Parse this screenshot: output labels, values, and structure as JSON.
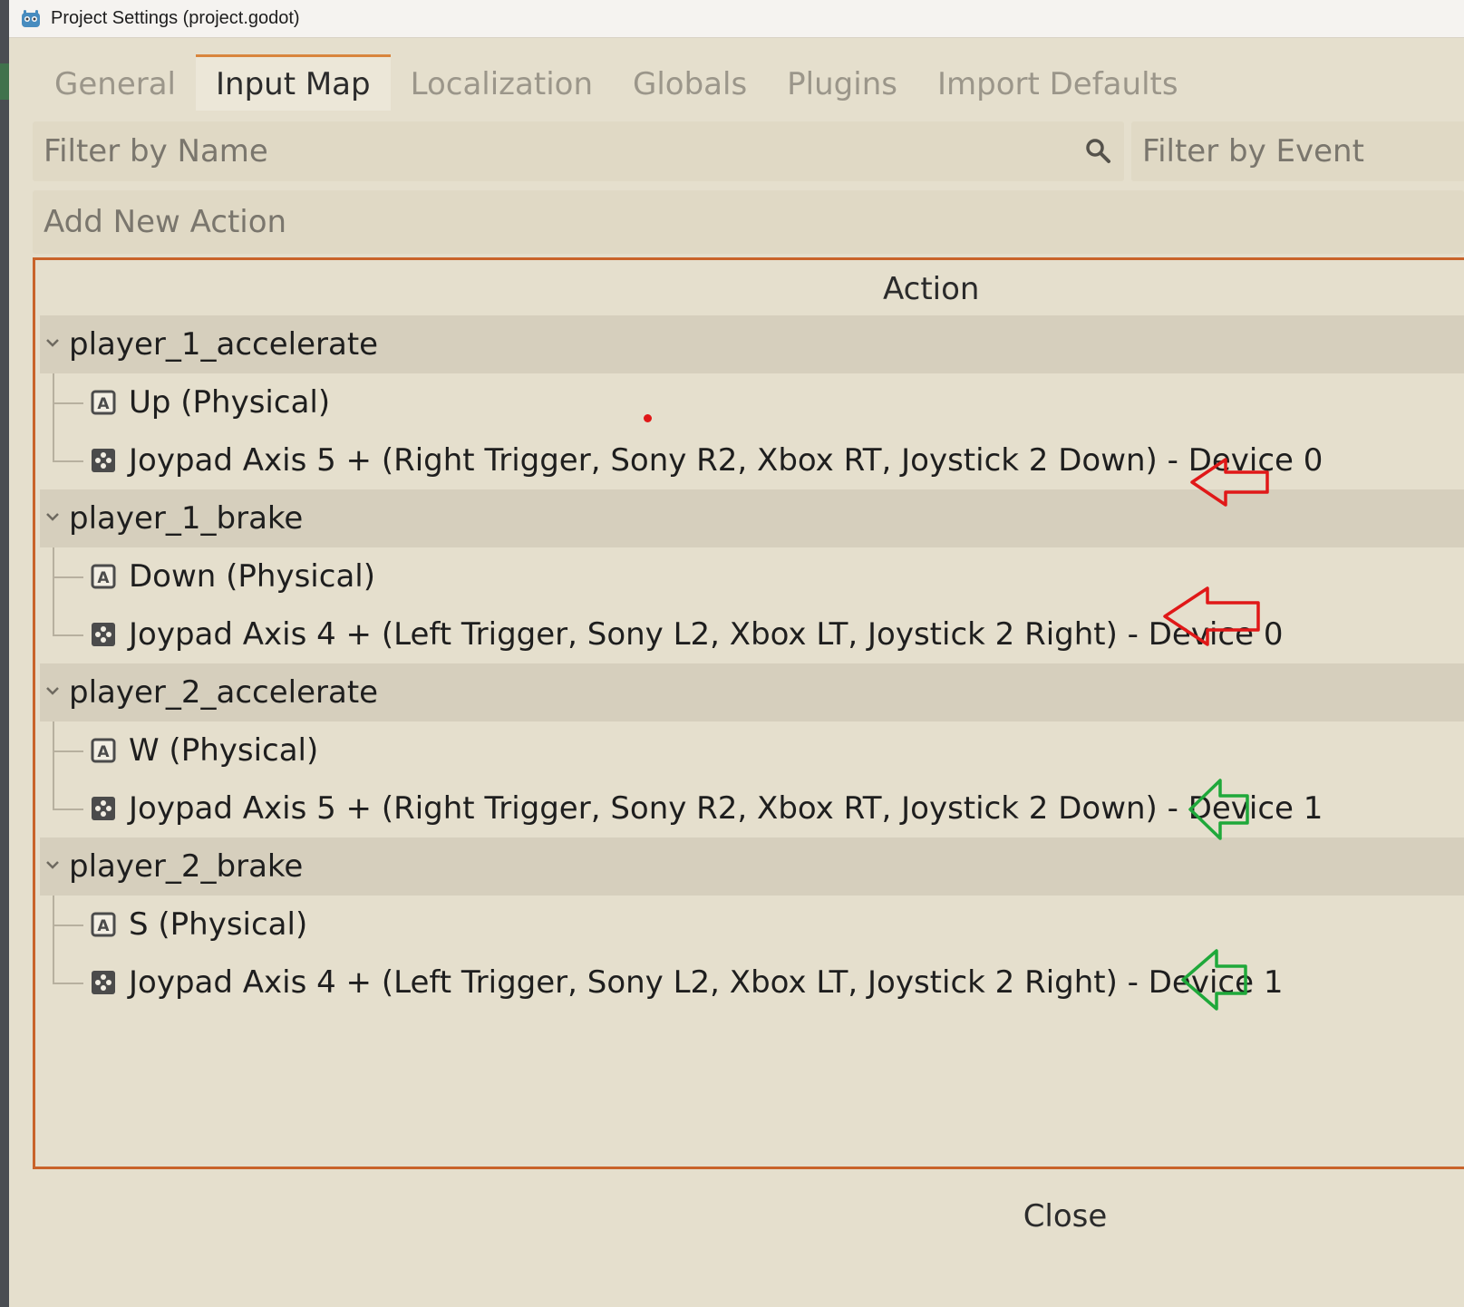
{
  "window": {
    "title": "Project Settings (project.godot)",
    "icon": "godot-logo-icon"
  },
  "tabs": [
    {
      "label": "General",
      "active": false
    },
    {
      "label": "Input Map",
      "active": true
    },
    {
      "label": "Localization",
      "active": false
    },
    {
      "label": "Globals",
      "active": false
    },
    {
      "label": "Plugins",
      "active": false
    },
    {
      "label": "Import Defaults",
      "active": false
    }
  ],
  "filters": {
    "name_placeholder": "Filter by Name",
    "event_placeholder": "Filter by Event",
    "search_icon": "search-icon"
  },
  "add_action": {
    "placeholder": "Add New Action"
  },
  "tree": {
    "header": "Action",
    "actions": [
      {
        "name": "player_1_accelerate",
        "events": [
          {
            "label": "Up (Physical)",
            "icon": "keyboard-key-icon"
          },
          {
            "label": "Joypad Axis 5 + (Right Trigger, Sony R2, Xbox RT, Joystick 2 Down) - Device 0",
            "icon": "joypad-icon",
            "annotation": "red-arrow"
          }
        ]
      },
      {
        "name": "player_1_brake",
        "events": [
          {
            "label": "Down (Physical)",
            "icon": "keyboard-key-icon"
          },
          {
            "label": "Joypad Axis 4 + (Left Trigger, Sony L2, Xbox LT, Joystick 2 Right) - Device 0",
            "icon": "joypad-icon",
            "annotation": "red-arrow"
          }
        ]
      },
      {
        "name": "player_2_accelerate",
        "events": [
          {
            "label": "W (Physical)",
            "icon": "keyboard-key-icon"
          },
          {
            "label": "Joypad Axis 5 + (Right Trigger, Sony R2, Xbox RT, Joystick 2 Down) - Device 1",
            "icon": "joypad-icon",
            "annotation": "green-arrow"
          }
        ]
      },
      {
        "name": "player_2_brake",
        "events": [
          {
            "label": "S (Physical)",
            "icon": "keyboard-key-icon"
          },
          {
            "label": "Joypad Axis 4 + (Left Trigger, Sony L2, Xbox LT, Joystick 2 Right) - Device 1",
            "icon": "joypad-icon",
            "annotation": "green-arrow"
          }
        ]
      }
    ]
  },
  "footer": {
    "close_label": "Close"
  },
  "colors": {
    "accent": "#c9632a",
    "tab_accent": "#d9853d",
    "red_annotation": "#e01818",
    "green_annotation": "#1fa83a"
  }
}
